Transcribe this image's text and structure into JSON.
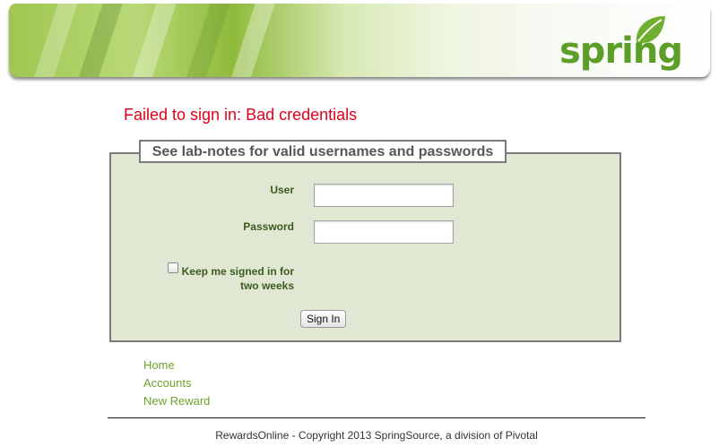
{
  "header": {
    "logo_text": "spring"
  },
  "error": {
    "message": "Failed to sign in: Bad credentials"
  },
  "login_form": {
    "legend": "See lab-notes for valid usernames and passwords",
    "user_label": "User",
    "user_value": "",
    "password_label": "Password",
    "password_value": "",
    "remember_line1": "Keep me signed in for",
    "remember_line2": "two weeks",
    "remember_checked": false,
    "submit_label": "Sign In"
  },
  "nav": {
    "items": [
      {
        "label": "Home"
      },
      {
        "label": "Accounts"
      },
      {
        "label": "New Reward"
      }
    ]
  },
  "footer": {
    "text": "RewardsOnline - Copyright 2013 SpringSource, a division of Pivotal"
  },
  "colors": {
    "error": "#e1001a",
    "brand_green": "#5c9f28",
    "link_green": "#6aa42a",
    "form_bg": "#e0e8d4"
  }
}
